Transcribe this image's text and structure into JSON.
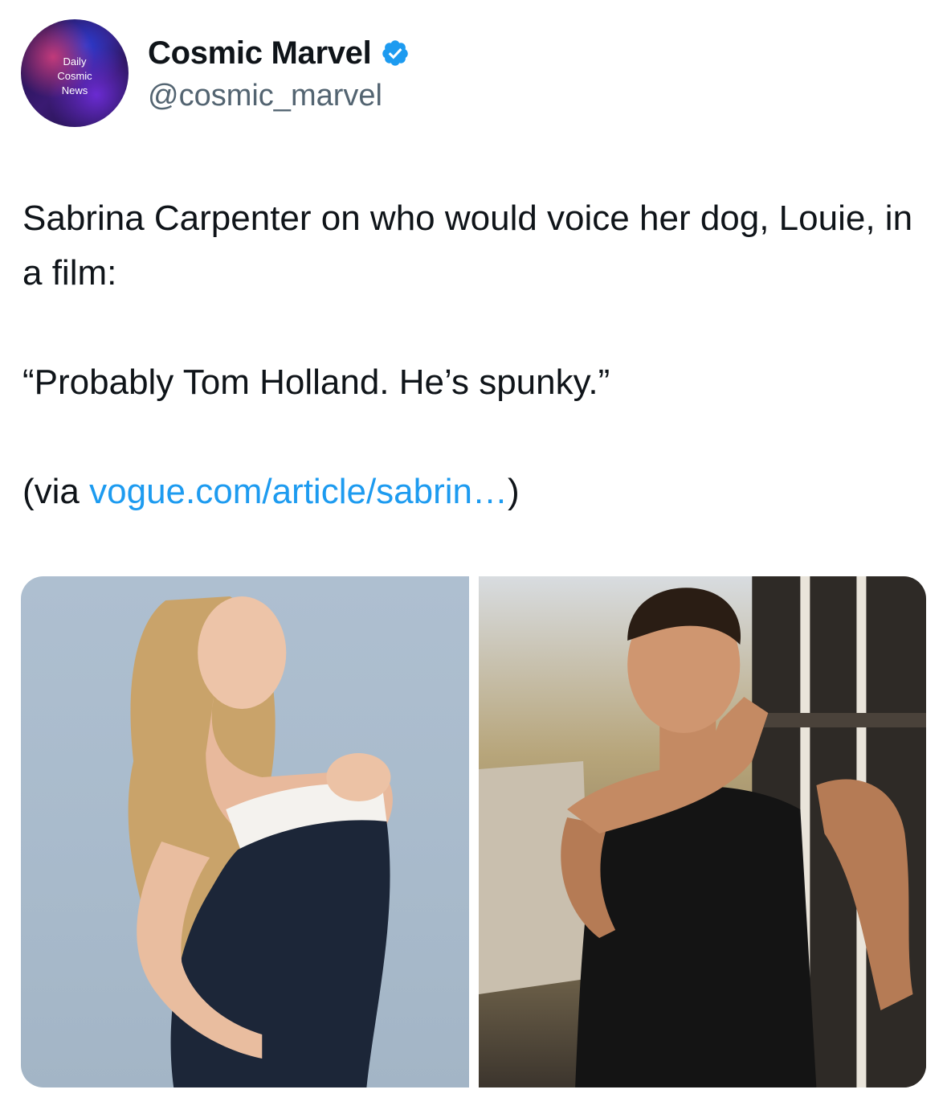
{
  "author": {
    "avatar_text": [
      "Daily",
      "Cosmic",
      "News"
    ],
    "display_name": "Cosmic Marvel",
    "handle": "@cosmic_marvel",
    "verified": true,
    "verified_badge_color": "#1d9bf0"
  },
  "tweet": {
    "line1": "Sabrina Carpenter on who would voice her dog, Louie, in a film:",
    "quote": "“Probably Tom Holland. He’s spunky.”",
    "via_prefix": "(via ",
    "via_link": "vogue.com/article/sabrin…",
    "via_suffix": ")",
    "link_color": "#1d9bf0"
  },
  "media": {
    "count": 2,
    "items": [
      {
        "icon": "photo-woman-portrait"
      },
      {
        "icon": "photo-man-portrait"
      }
    ]
  }
}
